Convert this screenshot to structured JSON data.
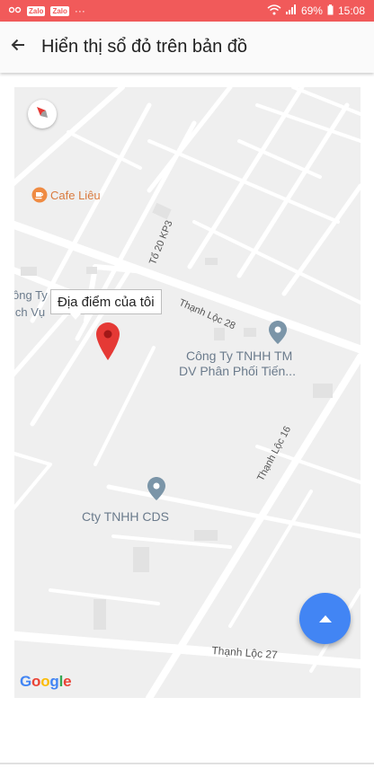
{
  "status_bar": {
    "badge1": "Zalo",
    "badge2": "Zalo",
    "dots": "···",
    "battery_percent": "69%",
    "time": "15:08",
    "color": "#f15a5a"
  },
  "app_bar": {
    "title": "Hiển thị sổ đỏ trên bản đồ",
    "back_icon": "arrow-left-icon"
  },
  "map": {
    "info_window_text": "Địa điểm của tôi",
    "cafe": "Cafe Liêu",
    "poi_company_left_1": "ông Ty",
    "poi_company_left_2": "ịch Vụ",
    "poi_company_right_1": "Công Ty TNHH TM",
    "poi_company_right_2": "DV Phân Phối Tiến...",
    "poi_cds": "Cty TNHH CDS",
    "road_thanh_loc_28": "Thạnh Lộc 28",
    "road_to20_kp3": "Tổ 20 KP3",
    "road_thanh_loc_16": "Thạnh Lộc 16",
    "road_thanh_loc_27": "Thạnh Lộc 27",
    "google_logo": "Google",
    "marker_color": "#e53935",
    "poi_pin_color": "#7b95a8"
  },
  "fab": {
    "icon": "arrow-up-icon",
    "color": "#4285f4"
  }
}
